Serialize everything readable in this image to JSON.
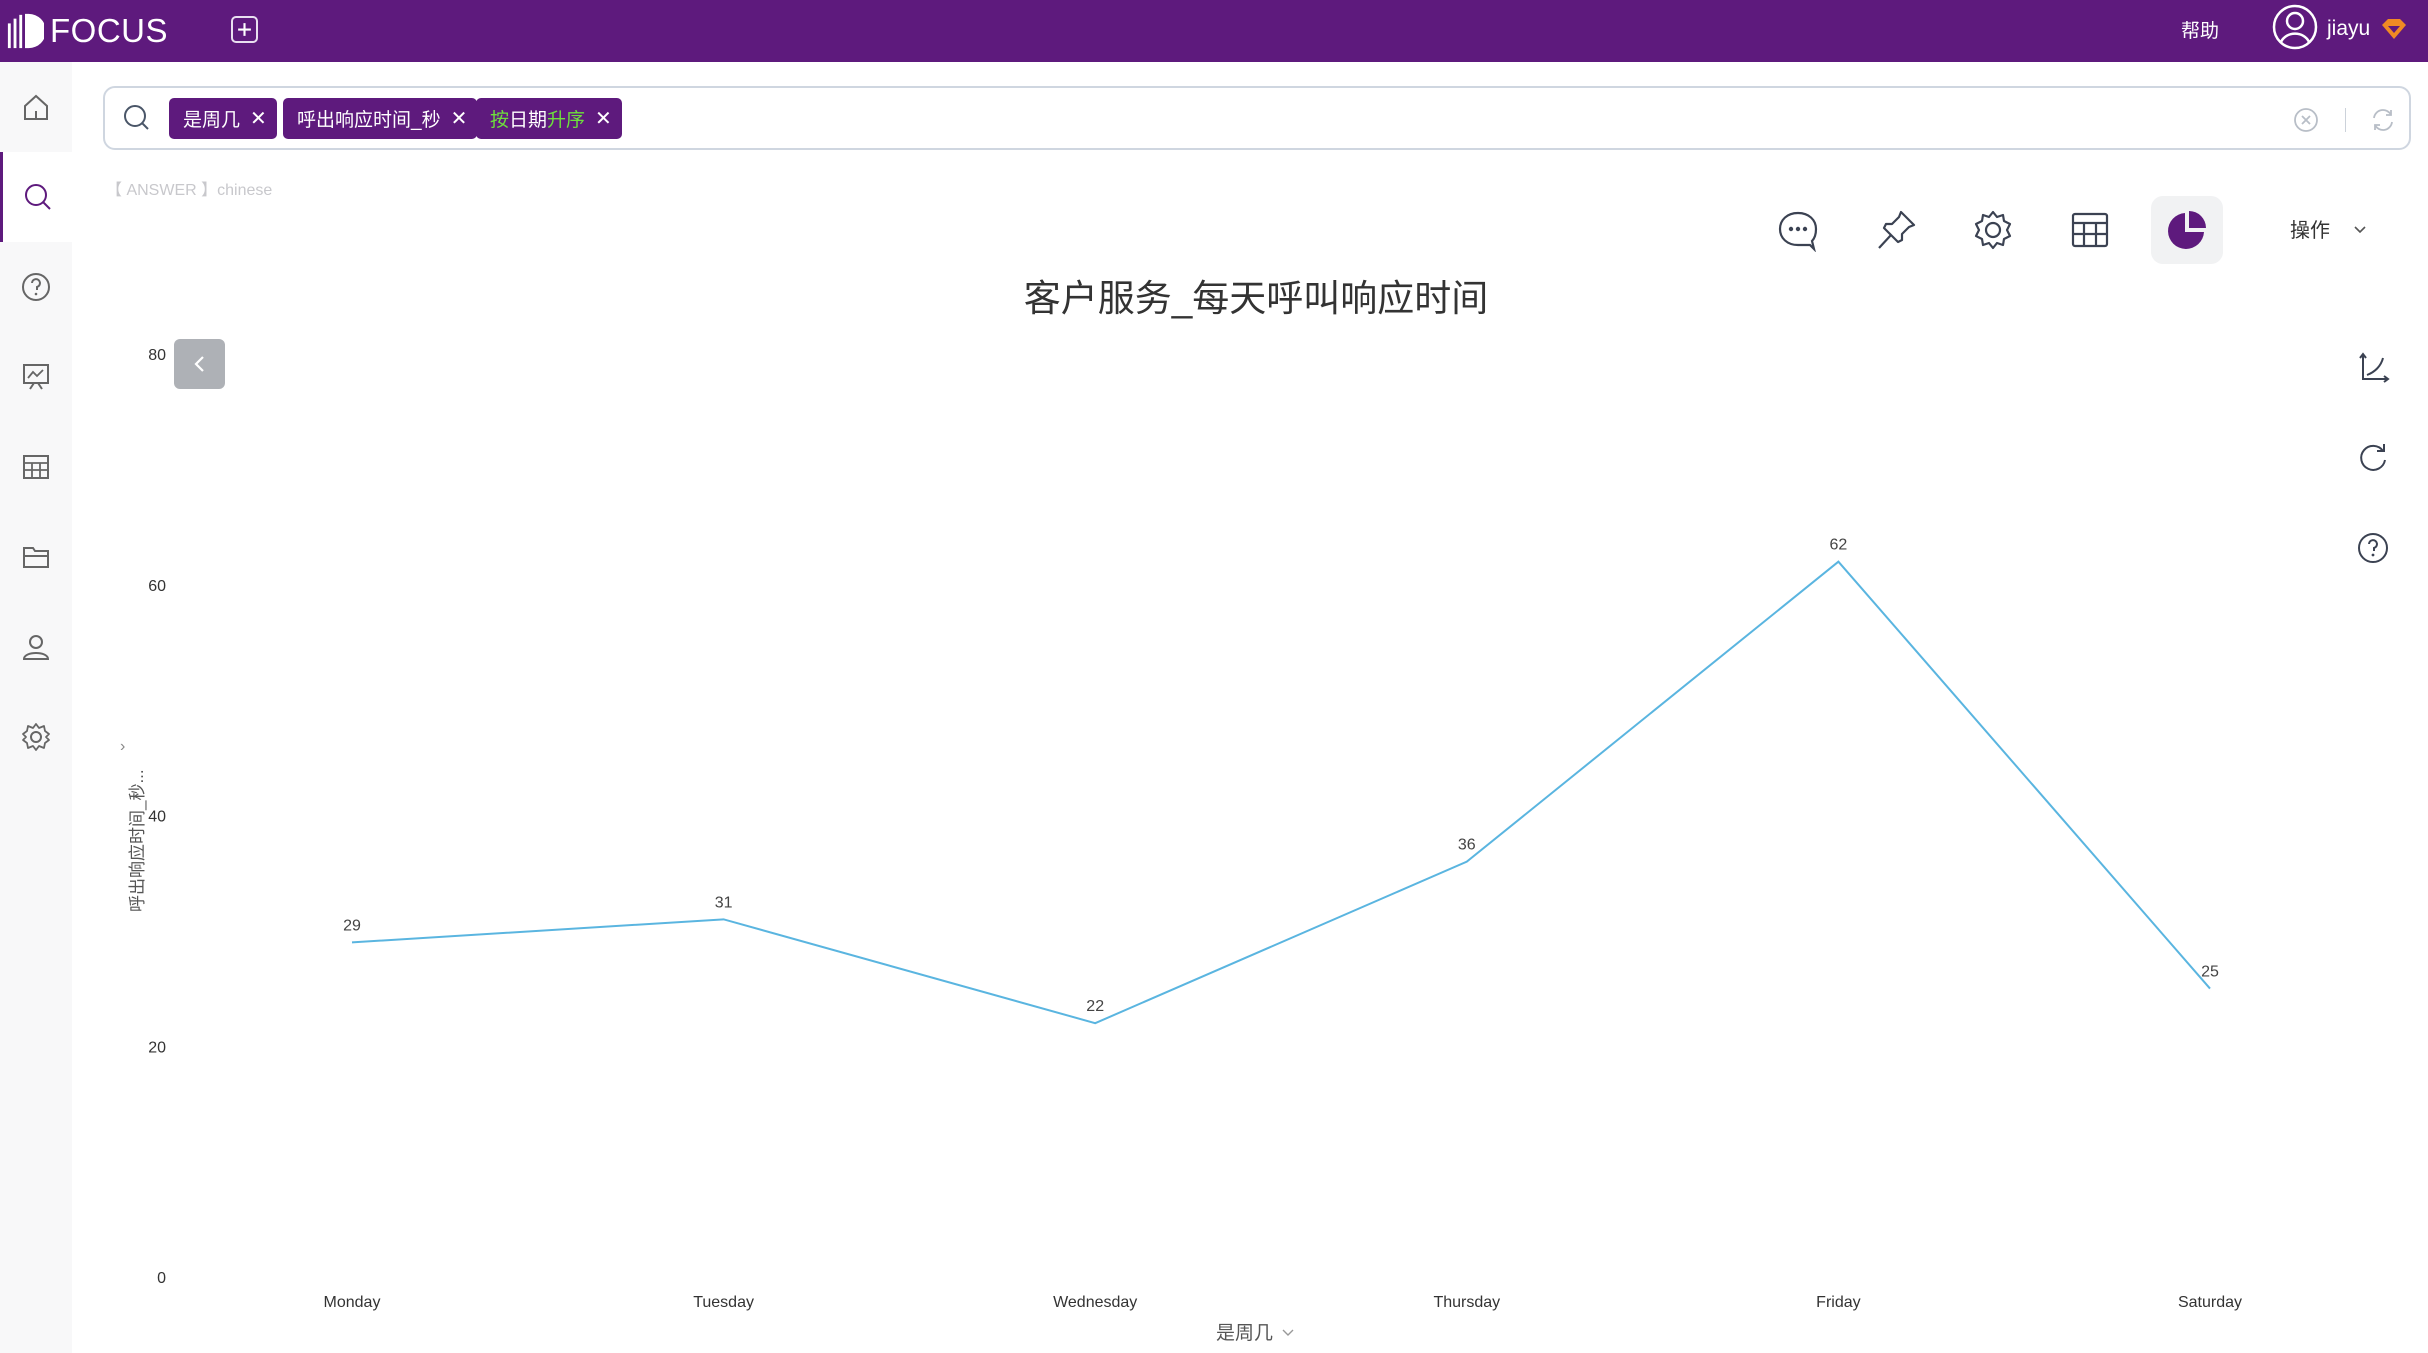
{
  "app": {
    "brand": "FOCUS",
    "help_label": "帮助",
    "username": "jiayu",
    "colors": {
      "brand": "#5e1a7d",
      "line": "#5ab5e0",
      "tag_green": "#6de03c"
    }
  },
  "sidebar": {
    "items": [
      {
        "name": "home",
        "icon": "home-icon"
      },
      {
        "name": "search",
        "icon": "search-icon",
        "active": true
      },
      {
        "name": "help",
        "icon": "question-icon"
      },
      {
        "name": "presentation",
        "icon": "presentation-chart-icon"
      },
      {
        "name": "table",
        "icon": "table-icon"
      },
      {
        "name": "folder",
        "icon": "folder-icon"
      },
      {
        "name": "user",
        "icon": "user-icon"
      },
      {
        "name": "settings",
        "icon": "gear-icon"
      }
    ]
  },
  "search": {
    "tags": [
      {
        "parts": [
          {
            "text": "是周几",
            "green": false
          }
        ]
      },
      {
        "parts": [
          {
            "text": "呼出响应时间_秒",
            "green": false
          }
        ]
      },
      {
        "parts": [
          {
            "text": "按",
            "green": true
          },
          {
            "text": "日期",
            "green": false
          },
          {
            "text": "升序",
            "green": true
          }
        ]
      }
    ]
  },
  "answer_label": "【 ANSWER 】chinese",
  "toolbar": {
    "buttons": [
      "comment-icon",
      "pin-icon",
      "gear-icon",
      "table-icon",
      "pie-chart-icon"
    ],
    "ops_label": "操作"
  },
  "side_tools": [
    "axis-icon",
    "refresh-icon",
    "help-icon"
  ],
  "chart_data": {
    "type": "line",
    "title": "客户服务_每天呼叫响应时间",
    "xlabel": "是周几",
    "ylabel": "呼出响应时间_秒...",
    "categories": [
      "Monday",
      "Tuesday",
      "Wednesday",
      "Thursday",
      "Friday",
      "Saturday"
    ],
    "series": [
      {
        "name": "呼出响应时间_秒",
        "values": [
          29,
          31,
          22,
          36,
          62,
          25
        ]
      }
    ],
    "ylim": [
      0,
      80
    ],
    "yticks": [
      0,
      20,
      40,
      60,
      80
    ],
    "grid": false,
    "legend": "none",
    "data_labels": true
  }
}
